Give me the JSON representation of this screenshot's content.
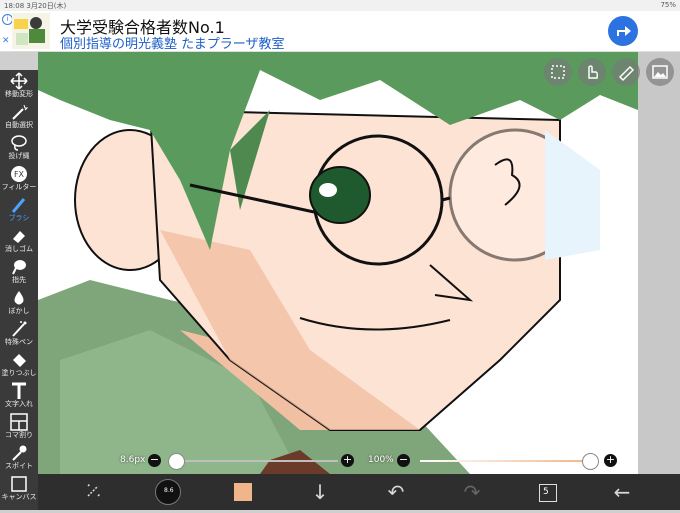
{
  "status": {
    "left": "18:08  3月20日(木)",
    "right": "75%"
  },
  "ad": {
    "title": "大学受験合格者数No.1",
    "subtitle": "個別指導の明光義塾 たまプラーザ教室",
    "info_icon": "info-icon",
    "close_icon": "close-icon"
  },
  "toolbar": {
    "items": [
      {
        "label": "移動変形",
        "icon": "move-icon"
      },
      {
        "label": "自動選択",
        "icon": "magic-wand-icon"
      },
      {
        "label": "投げ縄",
        "icon": "lasso-icon"
      },
      {
        "label": "フィルター",
        "icon": "filter-fx-icon"
      },
      {
        "label": "ブラシ",
        "icon": "brush-icon",
        "active": true
      },
      {
        "label": "消しゴム",
        "icon": "eraser-icon"
      },
      {
        "label": "指先",
        "icon": "finger-icon"
      },
      {
        "label": "ぼかし",
        "icon": "blur-drop-icon"
      },
      {
        "label": "特殊ペン",
        "icon": "special-pen-icon"
      },
      {
        "label": "塗りつぶし",
        "icon": "bucket-icon"
      },
      {
        "label": "文字入れ",
        "icon": "text-icon"
      },
      {
        "label": "コマ割り",
        "icon": "frame-divide-icon"
      },
      {
        "label": "スポイト",
        "icon": "eyedropper-icon"
      },
      {
        "label": "キャンバス",
        "icon": "canvas-icon"
      }
    ]
  },
  "brush": {
    "size_label": "8.6px",
    "size_fraction": 0.0,
    "opacity_label": "100%",
    "opacity_fraction": 1.0
  },
  "bottom": {
    "layers_count": "5",
    "color_hex": "#f0b58a",
    "brush_preview_label": "8.6"
  },
  "colors": {
    "hair": "#5a9a5c",
    "skin": "#fde3d4",
    "shadow": "#f1bfa2",
    "shirt": "#7fa57a",
    "accent": "#4aa3ff"
  }
}
